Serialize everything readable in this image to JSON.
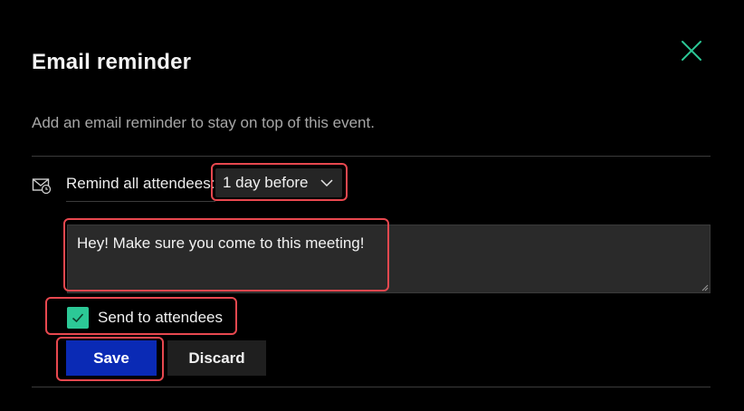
{
  "dialog": {
    "title": "Email reminder",
    "subtitle": "Add an email reminder to stay on top of this event.",
    "close_icon": "close-icon",
    "accent_color": "#2cc896"
  },
  "reminder": {
    "label": "Remind all attendees:",
    "selected": "1 day before",
    "icon": "mail-clock-icon"
  },
  "message": {
    "value": "Hey! Make sure you come to this meeting!"
  },
  "send_to_attendees": {
    "label": "Send to attendees",
    "checked": true
  },
  "actions": {
    "save_label": "Save",
    "discard_label": "Discard",
    "save_color": "#0a2ab5"
  },
  "annotation_color": "#e8484f"
}
